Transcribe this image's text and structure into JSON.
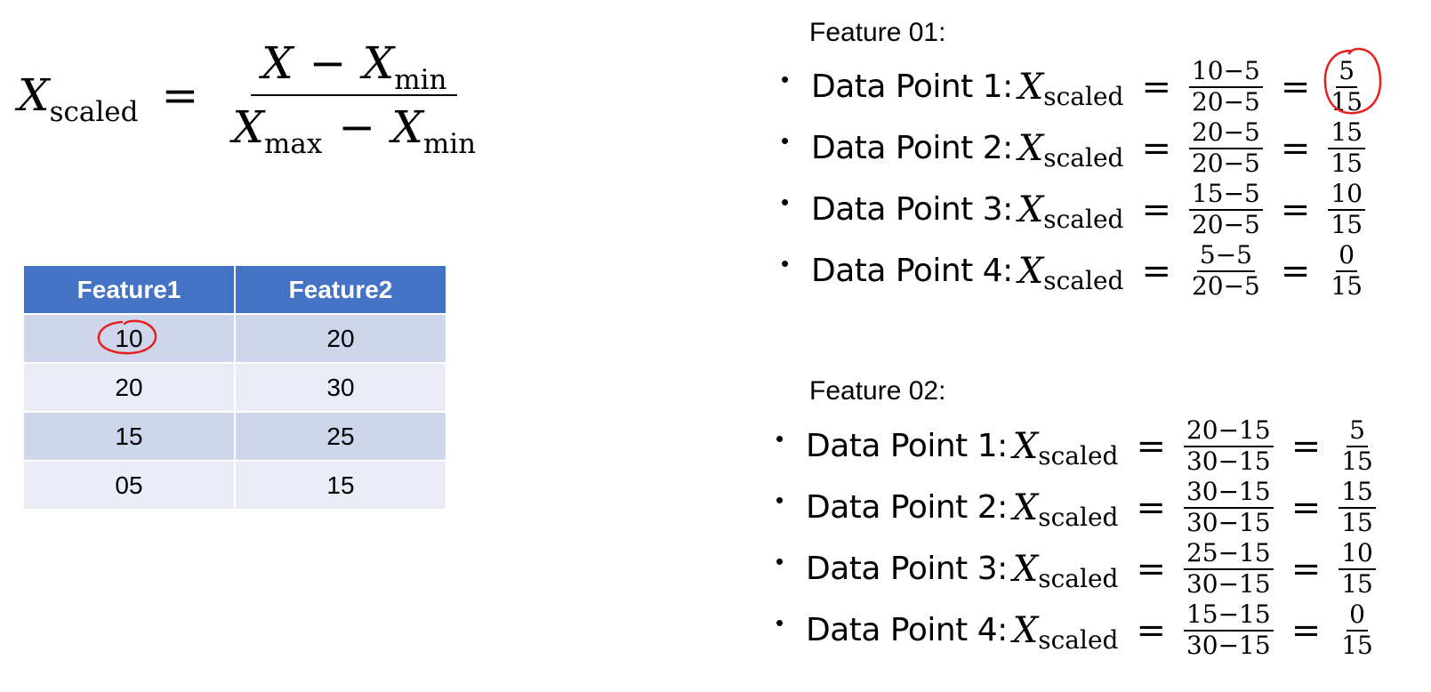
{
  "formula": {
    "lhs_var": "X",
    "lhs_sub": "scaled",
    "equals": "=",
    "num_var": "X",
    "num_minus": "−",
    "num_sub_var": "X",
    "num_sub": "min",
    "den_var": "X",
    "den_sub": "max",
    "den_minus": "−",
    "den_sub_var": "X",
    "den_sub2": "min"
  },
  "table": {
    "headers": [
      "Feature1",
      "Feature2"
    ],
    "rows": [
      [
        "10",
        "20"
      ],
      [
        "20",
        "30"
      ],
      [
        "15",
        "25"
      ],
      [
        "05",
        "15"
      ]
    ]
  },
  "feature01": {
    "heading": "Feature 01:",
    "items": [
      {
        "bullet": "•",
        "label": "Data Point 1:",
        "var": "X",
        "sub": "scaled",
        "eq": "=",
        "num": "10−5",
        "den": "20−5",
        "eq2": "=",
        "rnum": "5",
        "rden": "15"
      },
      {
        "bullet": "•",
        "label": "Data Point 2:",
        "var": "X",
        "sub": "scaled",
        "eq": "=",
        "num": "20−5",
        "den": "20−5",
        "eq2": "=",
        "rnum": "15",
        "rden": "15"
      },
      {
        "bullet": "•",
        "label": "Data Point 3:",
        "var": "X",
        "sub": "scaled",
        "eq": "=",
        "num": "15−5",
        "den": "20−5",
        "eq2": "=",
        "rnum": "10",
        "rden": "15"
      },
      {
        "bullet": "•",
        "label": "Data Point 4:",
        "var": "X",
        "sub": "scaled",
        "eq": "=",
        "num": "5−5",
        "den": "20−5",
        "eq2": "=",
        "rnum": "0",
        "rden": "15"
      }
    ]
  },
  "feature02": {
    "heading": "Feature 02:",
    "items": [
      {
        "bullet": "•",
        "label": "Data Point 1:",
        "var": "X",
        "sub": "scaled",
        "eq": "=",
        "num": "20−15",
        "den": "30−15",
        "eq2": "=",
        "rnum": "5",
        "rden": "15"
      },
      {
        "bullet": "•",
        "label": "Data Point 2:",
        "var": "X",
        "sub": "scaled",
        "eq": "=",
        "num": "30−15",
        "den": "30−15",
        "eq2": "=",
        "rnum": "15",
        "rden": "15"
      },
      {
        "bullet": "•",
        "label": "Data Point 3:",
        "var": "X",
        "sub": "scaled",
        "eq": "=",
        "num": "25−15",
        "den": "30−15",
        "eq2": "=",
        "rnum": "10",
        "rden": "15"
      },
      {
        "bullet": "•",
        "label": "Data Point 4:",
        "var": "X",
        "sub": "scaled",
        "eq": "=",
        "num": "15−15",
        "den": "30−15",
        "eq2": "=",
        "rnum": "0",
        "rden": "15"
      }
    ]
  },
  "colors": {
    "table_header": "#4472c4",
    "row_dark": "#cfd5ea",
    "row_light": "#e9ebf5",
    "annotation": "#e8201d"
  },
  "annotations": {
    "circled_cell": "table.rows.0.0",
    "circled_result": "feature01.items.0"
  }
}
